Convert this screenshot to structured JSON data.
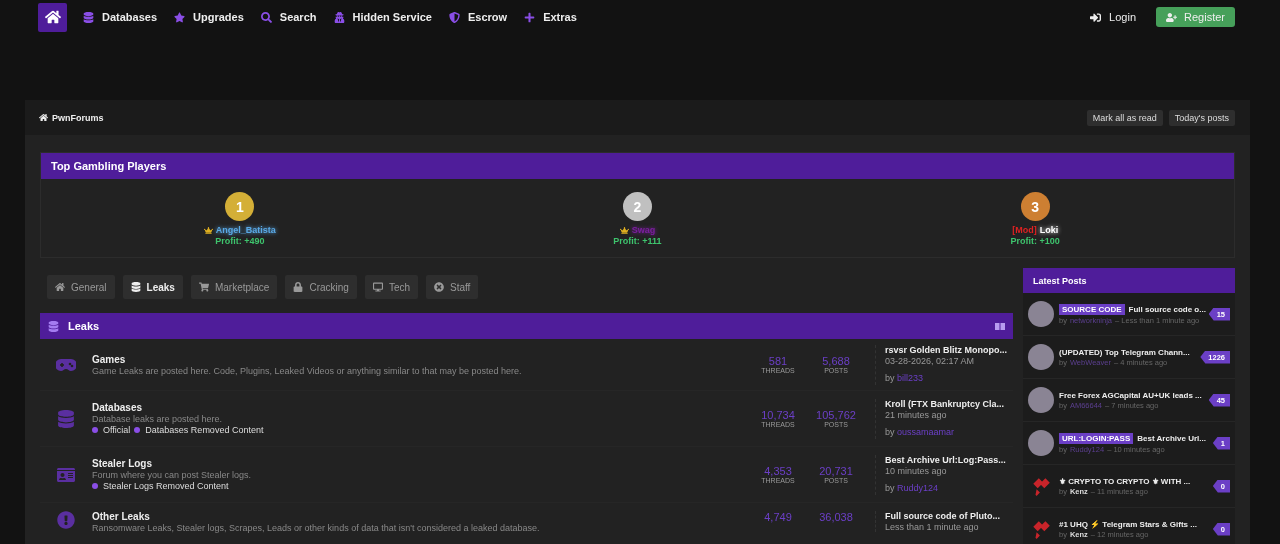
{
  "nav": {
    "items": [
      {
        "label": "Databases"
      },
      {
        "label": "Upgrades"
      },
      {
        "label": "Search"
      },
      {
        "label": "Hidden Service"
      },
      {
        "label": "Escrow"
      },
      {
        "label": "Extras"
      }
    ],
    "login": "Login",
    "register": "Register"
  },
  "breadcrumb": {
    "label": "PwnForums",
    "buttons": [
      "Mark all as read",
      "Today's posts"
    ]
  },
  "top_players": {
    "title": "Top Gambling Players",
    "players": [
      {
        "medal": {
          "label": "1",
          "color": "#d4af37"
        },
        "crown": true,
        "user": {
          "name": "Angel_Batista",
          "color": "#5aa9e6"
        },
        "profit": "Profit: +490"
      },
      {
        "medal": {
          "label": "2",
          "color": "#c0c0c0"
        },
        "crown": true,
        "user": {
          "name": "Swag",
          "color": "#7a1f9e"
        },
        "profit": "Profit: +111"
      },
      {
        "medal": {
          "label": "3",
          "color": "#cd7f32"
        },
        "crown": false,
        "prefix": "[Mod]",
        "user": {
          "name": "Loki",
          "color": "#ffffff"
        },
        "profit": "Profit: +100"
      }
    ]
  },
  "category_tabs": [
    {
      "label": "General",
      "selected": false
    },
    {
      "label": "Leaks",
      "selected": true
    },
    {
      "label": "Marketplace",
      "selected": false
    },
    {
      "label": "Cracking",
      "selected": false
    },
    {
      "label": "Tech",
      "selected": false
    },
    {
      "label": "Staff",
      "selected": false
    }
  ],
  "leaks": {
    "title": "Leaks",
    "forums": [
      {
        "name": "Games",
        "description": "Game Leaks are posted here. Code, Plugins, Leaked Videos or anything similar to that may be posted here.",
        "threads": {
          "value": "581",
          "label": "THREADS"
        },
        "posts": {
          "value": "5,688",
          "label": "POSTS"
        },
        "last_post": {
          "title": "rsvsr Golden Blitz Monopo...",
          "time": "03-28-2026, 02:17 AM",
          "by": "by",
          "user": "bill233"
        }
      },
      {
        "name": "Databases",
        "description": "Database leaks are posted here.",
        "subforums": [
          "Official",
          "Databases Removed Content"
        ],
        "threads": {
          "value": "10,734",
          "label": "THREADS"
        },
        "posts": {
          "value": "105,762",
          "label": "POSTS"
        },
        "last_post": {
          "title": "Kroll (FTX Bankruptcy Cla...",
          "time": "21 minutes ago",
          "by": "by",
          "user": "oussamaamar"
        }
      },
      {
        "name": "Stealer Logs",
        "description": "Forum where you can post Stealer logs.",
        "subforums": [
          "Stealer Logs Removed Content"
        ],
        "threads": {
          "value": "4,353",
          "label": "THREADS"
        },
        "posts": {
          "value": "20,731",
          "label": "POSTS"
        },
        "last_post": {
          "title": "Best Archive Url:Log:Pass...",
          "time": "10 minutes ago",
          "by": "by",
          "user": "Ruddy124"
        }
      },
      {
        "name": "Other Leaks",
        "description": "Ransomware Leaks, Stealer logs, Scrapes, Leads or other kinds of data that isn't considered a leaked database.",
        "threads": {
          "value": "4,749"
        },
        "posts": {
          "value": "36,038"
        },
        "last_post": {
          "title": "Full source code of Pluto...",
          "time": "Less than 1 minute ago"
        }
      }
    ]
  },
  "latest_posts": {
    "title": "Latest Posts",
    "posts": [
      {
        "kind": "photo",
        "prefix": "SOURCE CODE",
        "title": "Full source code o...",
        "by": "by",
        "user": {
          "name": "networkninja",
          "kind": "member"
        },
        "time": "– Less than 1 minute ago",
        "count": "15"
      },
      {
        "kind": "photo",
        "title": "(UPDATED) Top Telegram Chann...",
        "by": "by",
        "user": {
          "name": "WebWeaver",
          "kind": "member"
        },
        "time": "– 4 minutes ago",
        "count": "1226"
      },
      {
        "kind": "photo",
        "title": "Free Forex AGCapital AU+UK leads ...",
        "by": "by",
        "user": {
          "name": "AM66644",
          "kind": "member"
        },
        "time": "– 7 minutes ago",
        "count": "45"
      },
      {
        "kind": "photo",
        "prefix": "URL:LOGIN:PASS",
        "title": "Best Archive Url...",
        "by": "by",
        "user": {
          "name": "Ruddy124",
          "kind": "member"
        },
        "time": "– 10 minutes ago",
        "count": "1"
      },
      {
        "kind": "logo",
        "title": "⚜ CRYPTO TO CRYPTO ⚜ WITH ...",
        "by": "by",
        "user": {
          "name": "Kenz",
          "kind": "plain"
        },
        "time": "– 11 minutes ago",
        "count": "0"
      },
      {
        "kind": "logo",
        "title": "#1 UHQ ⚡ Telegram Stars & Gifts ...",
        "by": "by",
        "user": {
          "name": "Kenz",
          "kind": "plain"
        },
        "time": "– 12 minutes ago",
        "count": "0"
      }
    ]
  }
}
